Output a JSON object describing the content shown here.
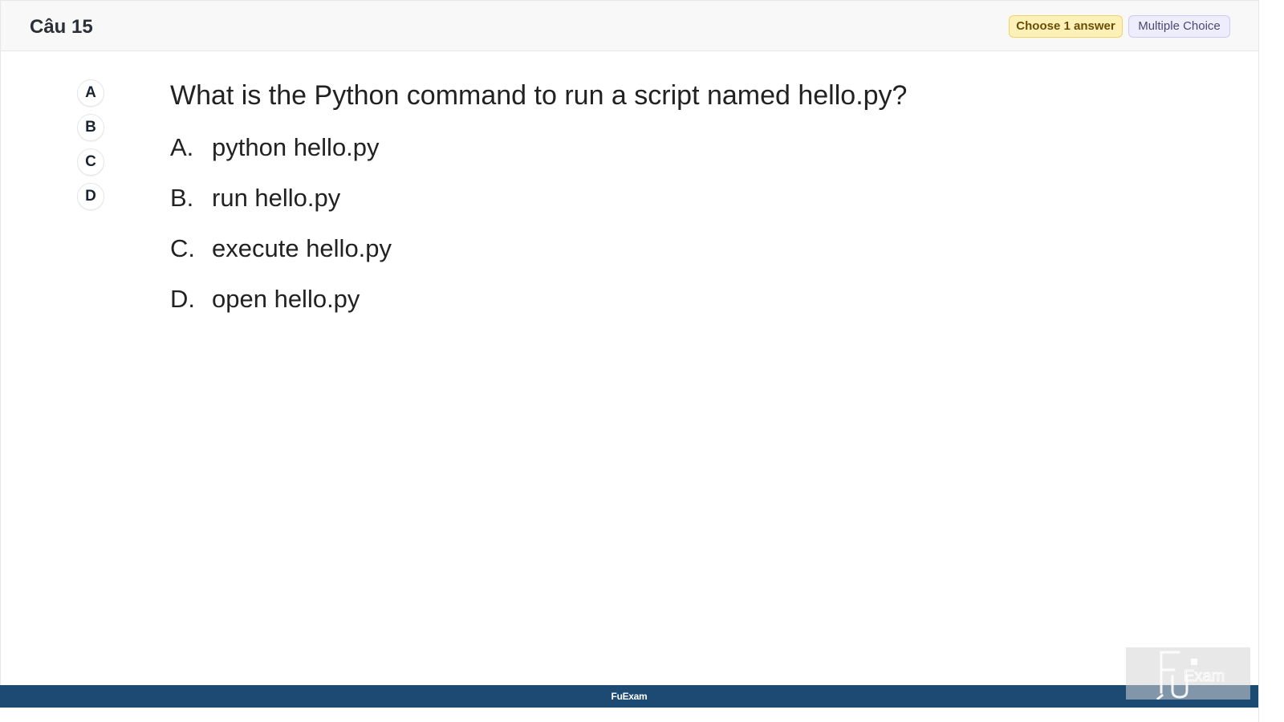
{
  "header": {
    "question_number": "Câu 15",
    "choose_badge": "Choose 1 answer",
    "type_badge": "Multiple Choice"
  },
  "answer_selector": {
    "choices": [
      "A",
      "B",
      "C",
      "D"
    ]
  },
  "question": {
    "text": "What is the Python command to run a script named hello.py?",
    "options": [
      {
        "letter": "A.",
        "text": "python hello.py"
      },
      {
        "letter": "B.",
        "text": "run hello.py"
      },
      {
        "letter": "C.",
        "text": "execute hello.py"
      },
      {
        "letter": "D.",
        "text": "open hello.py"
      }
    ]
  },
  "footer": {
    "label": "FuExam"
  },
  "watermark": {
    "text": "Exam"
  },
  "colors": {
    "footer_bg": "#1c4a72",
    "choose_badge_bg": "#fdf1b8",
    "type_badge_bg": "#eeedfd"
  }
}
